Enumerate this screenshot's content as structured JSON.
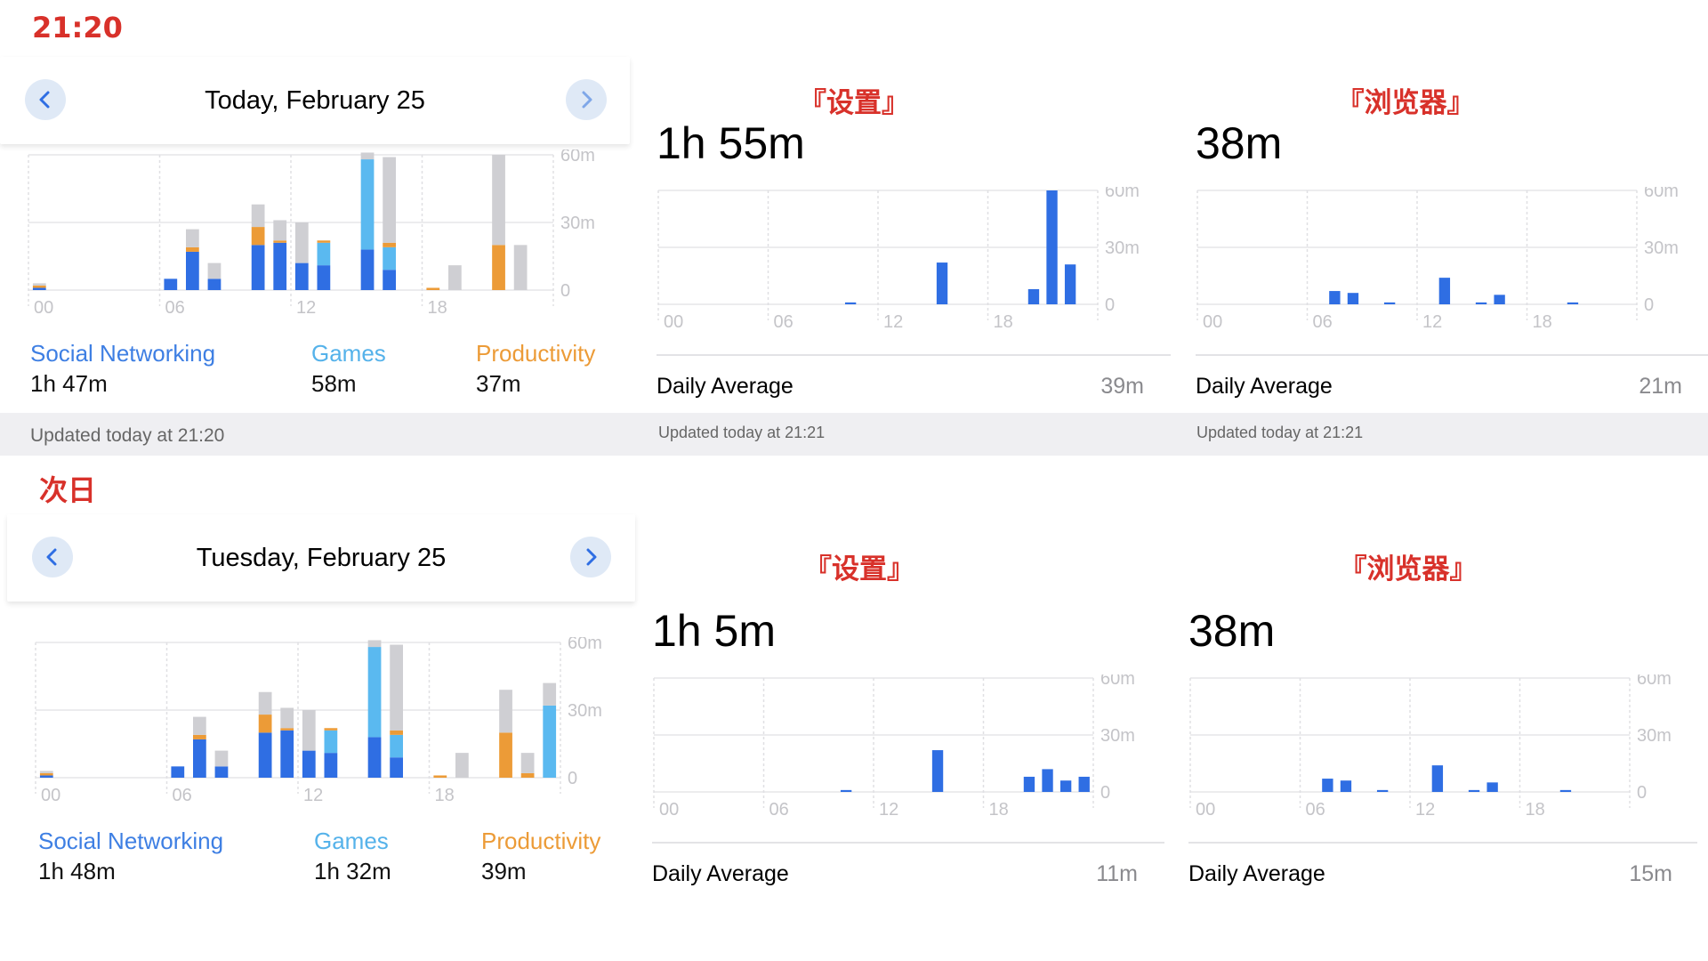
{
  "labels": {
    "time_top": "21:20",
    "next_day": "次日",
    "settings": "『设置』",
    "browser": "『浏览器』"
  },
  "colors": {
    "social": "#2f6ee3",
    "games": "#5ab9f0",
    "productivity": "#ec9b37",
    "other": "#cfcfd3",
    "single_app": "#2f6ee3",
    "annotation": "#d8312a"
  },
  "icons": {
    "prev": "chevron-left-icon",
    "next": "chevron-right-icon"
  },
  "top": {
    "date": "Today, February 25",
    "categories": [
      {
        "label": "Social Networking",
        "value": "1h 47m"
      },
      {
        "label": "Games",
        "value": "58m"
      },
      {
        "label": "Productivity",
        "value": "37m"
      }
    ],
    "updated": "Updated today at 21:20",
    "settings": {
      "total": "1h 55m",
      "avg_label": "Daily Average",
      "avg_value": "39m",
      "updated": "Updated today at 21:21"
    },
    "browser": {
      "total": "38m",
      "avg_label": "Daily Average",
      "avg_value": "21m",
      "updated": "Updated today at 21:21"
    }
  },
  "bottom": {
    "date": "Tuesday, February 25",
    "categories": [
      {
        "label": "Social Networking",
        "value": "1h 48m"
      },
      {
        "label": "Games",
        "value": "1h 32m"
      },
      {
        "label": "Productivity",
        "value": "39m"
      }
    ],
    "settings": {
      "total": "1h 5m",
      "avg_label": "Daily Average",
      "avg_value": "11m"
    },
    "browser": {
      "total": "38m",
      "avg_label": "Daily Average",
      "avg_value": "15m"
    }
  },
  "chart_data": [
    {
      "id": "top-overall",
      "type": "bar",
      "stacked": true,
      "x": [
        0,
        1,
        2,
        3,
        4,
        5,
        6,
        7,
        8,
        9,
        10,
        11,
        12,
        13,
        14,
        15,
        16,
        17,
        18,
        19,
        20,
        21,
        22,
        23
      ],
      "x_tick_labels": [
        "00",
        "06",
        "12",
        "18"
      ],
      "y_tick_labels": [
        "60m",
        "30m",
        "0"
      ],
      "ylim": [
        0,
        60
      ],
      "series": [
        {
          "name": "Social Networking",
          "color": "#2f6ee3",
          "values": [
            1,
            0,
            0,
            0,
            0,
            0,
            5,
            17,
            5,
            0,
            20,
            21,
            12,
            11,
            0,
            18,
            9,
            0,
            0,
            0,
            0,
            0,
            0,
            0
          ]
        },
        {
          "name": "Games",
          "color": "#5ab9f0",
          "values": [
            0,
            0,
            0,
            0,
            0,
            0,
            0,
            0,
            0,
            0,
            0,
            0,
            0,
            10,
            0,
            40,
            10,
            0,
            0,
            0,
            0,
            0,
            0,
            0
          ]
        },
        {
          "name": "Productivity",
          "color": "#ec9b37",
          "values": [
            1,
            0,
            0,
            0,
            0,
            0,
            0,
            2,
            0,
            0,
            8,
            1,
            0,
            1,
            0,
            0,
            2,
            0,
            1,
            0,
            0,
            20,
            0,
            0
          ]
        },
        {
          "name": "Other",
          "color": "#cfcfd3",
          "values": [
            1,
            0,
            0,
            0,
            0,
            0,
            0,
            8,
            7,
            0,
            10,
            9,
            18,
            0,
            0,
            3,
            38,
            0,
            0,
            11,
            0,
            40,
            20,
            0
          ]
        }
      ],
      "grid": true
    },
    {
      "id": "top-settings",
      "type": "bar",
      "x": [
        0,
        1,
        2,
        3,
        4,
        5,
        6,
        7,
        8,
        9,
        10,
        11,
        12,
        13,
        14,
        15,
        16,
        17,
        18,
        19,
        20,
        21,
        22,
        23
      ],
      "x_tick_labels": [
        "00",
        "06",
        "12",
        "18"
      ],
      "y_tick_labels": [
        "60m",
        "30m",
        "0"
      ],
      "ylim": [
        0,
        60
      ],
      "values": [
        0,
        0,
        0,
        0,
        0,
        0,
        0,
        0,
        0,
        0,
        1,
        0,
        0,
        0,
        0,
        22,
        0,
        0,
        0,
        0,
        8,
        60,
        21,
        0
      ],
      "grid": true
    },
    {
      "id": "top-browser",
      "type": "bar",
      "x": [
        0,
        1,
        2,
        3,
        4,
        5,
        6,
        7,
        8,
        9,
        10,
        11,
        12,
        13,
        14,
        15,
        16,
        17,
        18,
        19,
        20,
        21,
        22,
        23
      ],
      "x_tick_labels": [
        "00",
        "06",
        "12",
        "18"
      ],
      "y_tick_labels": [
        "60m",
        "30m",
        "0"
      ],
      "ylim": [
        0,
        60
      ],
      "values": [
        0,
        0,
        0,
        0,
        0,
        0,
        0,
        7,
        6,
        0,
        1,
        0,
        0,
        14,
        0,
        1,
        5,
        0,
        0,
        0,
        1,
        0,
        0,
        0
      ],
      "grid": true
    },
    {
      "id": "bottom-overall",
      "type": "bar",
      "stacked": true,
      "x": [
        0,
        1,
        2,
        3,
        4,
        5,
        6,
        7,
        8,
        9,
        10,
        11,
        12,
        13,
        14,
        15,
        16,
        17,
        18,
        19,
        20,
        21,
        22,
        23
      ],
      "x_tick_labels": [
        "00",
        "06",
        "12",
        "18"
      ],
      "y_tick_labels": [
        "60m",
        "30m",
        "0"
      ],
      "ylim": [
        0,
        60
      ],
      "series": [
        {
          "name": "Social Networking",
          "color": "#2f6ee3",
          "values": [
            1,
            0,
            0,
            0,
            0,
            0,
            5,
            17,
            5,
            0,
            20,
            21,
            12,
            11,
            0,
            18,
            9,
            0,
            0,
            0,
            0,
            0,
            0,
            0
          ]
        },
        {
          "name": "Games",
          "color": "#5ab9f0",
          "values": [
            0,
            0,
            0,
            0,
            0,
            0,
            0,
            0,
            0,
            0,
            0,
            0,
            0,
            10,
            0,
            40,
            10,
            0,
            0,
            0,
            0,
            0,
            0,
            32
          ]
        },
        {
          "name": "Productivity",
          "color": "#ec9b37",
          "values": [
            1,
            0,
            0,
            0,
            0,
            0,
            0,
            2,
            0,
            0,
            8,
            1,
            0,
            1,
            0,
            0,
            2,
            0,
            1,
            0,
            0,
            20,
            2,
            0
          ]
        },
        {
          "name": "Other",
          "color": "#cfcfd3",
          "values": [
            1,
            0,
            0,
            0,
            0,
            0,
            0,
            8,
            7,
            0,
            10,
            9,
            18,
            0,
            0,
            3,
            38,
            0,
            0,
            11,
            0,
            19,
            9,
            10
          ]
        }
      ],
      "grid": true
    },
    {
      "id": "bottom-settings",
      "type": "bar",
      "x": [
        0,
        1,
        2,
        3,
        4,
        5,
        6,
        7,
        8,
        9,
        10,
        11,
        12,
        13,
        14,
        15,
        16,
        17,
        18,
        19,
        20,
        21,
        22,
        23
      ],
      "x_tick_labels": [
        "00",
        "06",
        "12",
        "18"
      ],
      "y_tick_labels": [
        "60m",
        "30m",
        "0"
      ],
      "ylim": [
        0,
        60
      ],
      "values": [
        0,
        0,
        0,
        0,
        0,
        0,
        0,
        0,
        0,
        0,
        1,
        0,
        0,
        0,
        0,
        22,
        0,
        0,
        0,
        0,
        8,
        12,
        6,
        8
      ],
      "grid": true
    },
    {
      "id": "bottom-browser",
      "type": "bar",
      "x": [
        0,
        1,
        2,
        3,
        4,
        5,
        6,
        7,
        8,
        9,
        10,
        11,
        12,
        13,
        14,
        15,
        16,
        17,
        18,
        19,
        20,
        21,
        22,
        23
      ],
      "x_tick_labels": [
        "00",
        "06",
        "12",
        "18"
      ],
      "y_tick_labels": [
        "60m",
        "30m",
        "0"
      ],
      "ylim": [
        0,
        60
      ],
      "values": [
        0,
        0,
        0,
        0,
        0,
        0,
        0,
        7,
        6,
        0,
        1,
        0,
        0,
        14,
        0,
        1,
        5,
        0,
        0,
        0,
        1,
        0,
        0,
        0
      ],
      "grid": true
    }
  ]
}
